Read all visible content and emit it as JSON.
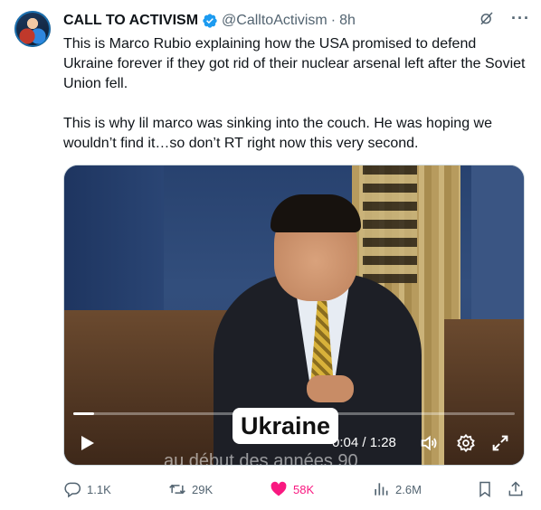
{
  "tweet": {
    "author_name": "CALL TO ACTIVISM",
    "handle": "@CalltoActivism",
    "separator": "·",
    "time": "8h",
    "text": "This is Marco Rubio explaining how the USA promised to defend Ukraine forever if they got rid of their nuclear arsenal left after the Soviet Union fell.\n\nThis is why lil marco was sinking into the couch. He was hoping we wouldn’t find it…so don’t RT right now this very second."
  },
  "video": {
    "caption": "Ukraine",
    "subtitle": "au début des années 90",
    "time_readout": "0:04 / 1:28",
    "progress_fraction": 0.047
  },
  "actions": {
    "replies": "1.1K",
    "retweets": "29K",
    "likes": "58K",
    "views": "2.6M"
  },
  "colors": {
    "accent": "#1d9bf0",
    "like": "#f91880",
    "secondary_text": "#536471"
  },
  "icons": [
    "verified-badge-icon",
    "grok-icon",
    "more-icon",
    "play-icon",
    "volume-icon",
    "settings-icon",
    "expand-icon",
    "reply-icon",
    "retweet-icon",
    "like-icon",
    "views-icon",
    "bookmark-icon",
    "share-icon"
  ]
}
